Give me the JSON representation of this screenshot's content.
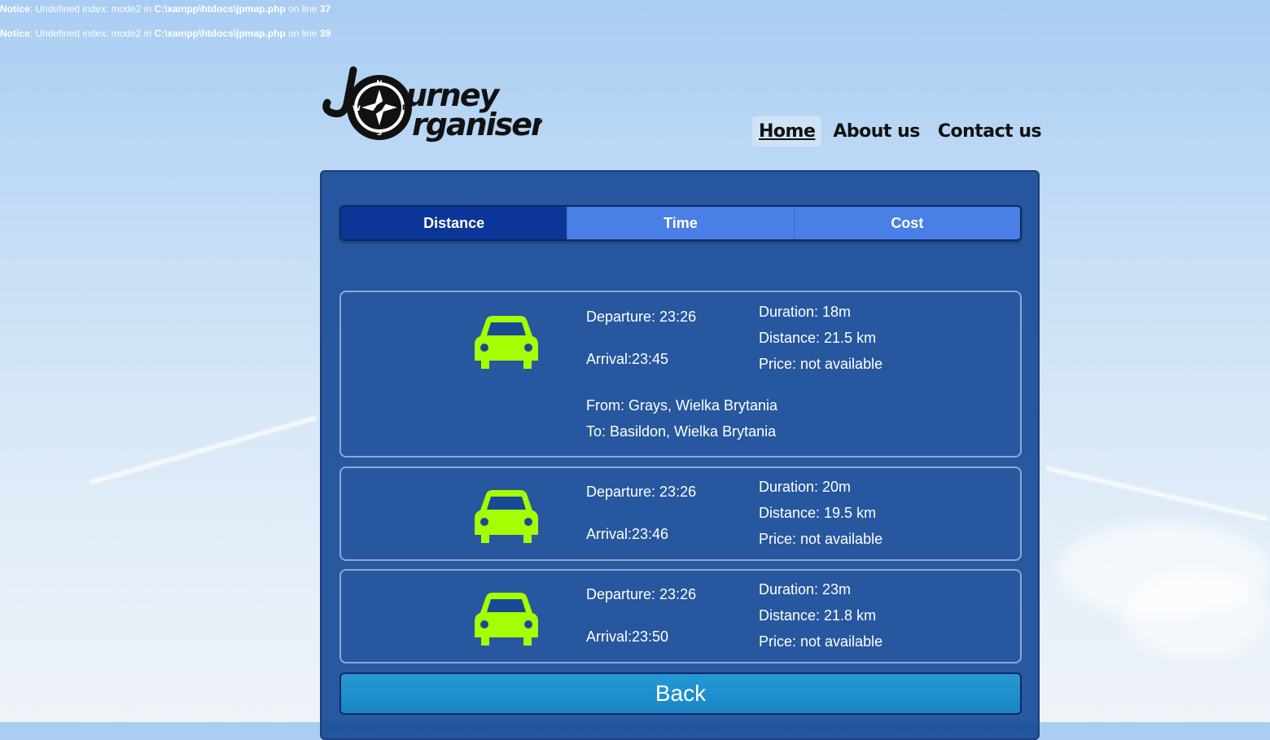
{
  "notices": [
    {
      "label": "Notice",
      "message": ": Undefined index: mode2 in ",
      "path": "C:\\xampp\\htdocs\\jpmap.php",
      "suffix": " on line ",
      "line": "37"
    },
    {
      "label": "Notice",
      "message": ": Undefined index: mode2 in ",
      "path": "C:\\xampp\\htdocs\\jpmap.php",
      "suffix": " on line ",
      "line": "39"
    }
  ],
  "logo": {
    "line1": "urney",
    "line2": "rganiser",
    "compass": [
      "N",
      "E",
      "S",
      "W"
    ]
  },
  "nav": {
    "home": "Home",
    "about": "About us",
    "contact": "Contact us"
  },
  "tabs": {
    "distance": "Distance",
    "time": "Time",
    "cost": "Cost",
    "active": "Distance"
  },
  "results": [
    {
      "departure": "Departure: 23:26",
      "arrival": "Arrival:23:45",
      "duration": "Duration: 18m",
      "distance": "Distance: 21.5 km",
      "price": "Price: not available",
      "from": "From: Grays, Wielka Brytania",
      "to": "To: Basildon, Wielka Brytania",
      "icon": "car-icon"
    },
    {
      "departure": "Departure: 23:26",
      "arrival": "Arrival:23:46",
      "duration": "Duration: 20m",
      "distance": "Distance: 19.5 km",
      "price": "Price: not available",
      "icon": "car-icon"
    },
    {
      "departure": "Departure: 23:26",
      "arrival": "Arrival:23:50",
      "duration": "Duration: 23m",
      "distance": "Distance: 21.8 km",
      "price": "Price: not available",
      "icon": "car-icon"
    }
  ],
  "back_label": "Back",
  "colors": {
    "panel": "#184b96",
    "tab_active": "#0b3596",
    "tab_inactive": "#4a7fe6",
    "car": "#a6ff00",
    "back_button": "#1f8fcd"
  }
}
